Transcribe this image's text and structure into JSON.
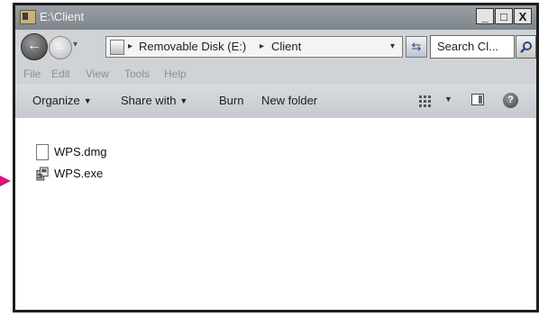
{
  "window": {
    "title": "E:\\Client",
    "controls": {
      "minimize": "_",
      "maximize": "□",
      "close": "X"
    }
  },
  "address_bar": {
    "breadcrumbs": [
      "Removable Disk (E:)",
      "Client"
    ],
    "separator": "▸",
    "search_placeholder": "Search Cl..."
  },
  "menu": {
    "items": [
      "File",
      "Edit",
      "View",
      "Tools",
      "Help"
    ]
  },
  "command_bar": {
    "organize": "Organize",
    "share_with": "Share with",
    "burn": "Burn",
    "new_folder": "New folder"
  },
  "files": [
    {
      "name": "WPS.dmg",
      "icon": "document-icon"
    },
    {
      "name": "WPS.exe",
      "icon": "installer-icon"
    }
  ],
  "colors": {
    "pointer_arrow": "#e0107a"
  }
}
